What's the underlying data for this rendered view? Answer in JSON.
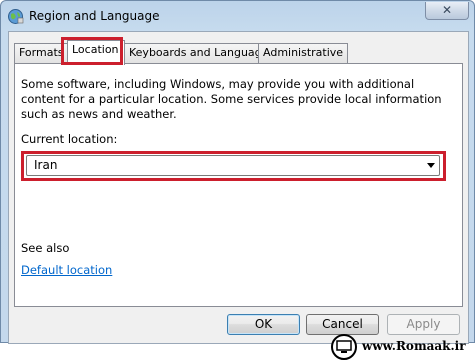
{
  "window": {
    "title": "Region and Language",
    "close_glyph": "✕"
  },
  "tabs": [
    {
      "label": "Formats",
      "active": false
    },
    {
      "label": "Location",
      "active": true
    },
    {
      "label": "Keyboards and Languages",
      "active": false
    },
    {
      "label": "Administrative",
      "active": false
    }
  ],
  "location_panel": {
    "description": "Some software, including Windows, may provide you with additional content for a particular location. Some services provide local information such as news and weather.",
    "current_location_label": "Current location:",
    "current_location_value": "Iran",
    "see_also_label": "See also",
    "default_location_link": "Default location"
  },
  "buttons": {
    "ok": "OK",
    "cancel": "Cancel",
    "apply": "Apply"
  },
  "watermark": {
    "text": "www.Romaak.ir"
  },
  "colors": {
    "highlight": "#cc1f2d",
    "link": "#0066cc",
    "titlebar": "#c6dbee"
  }
}
